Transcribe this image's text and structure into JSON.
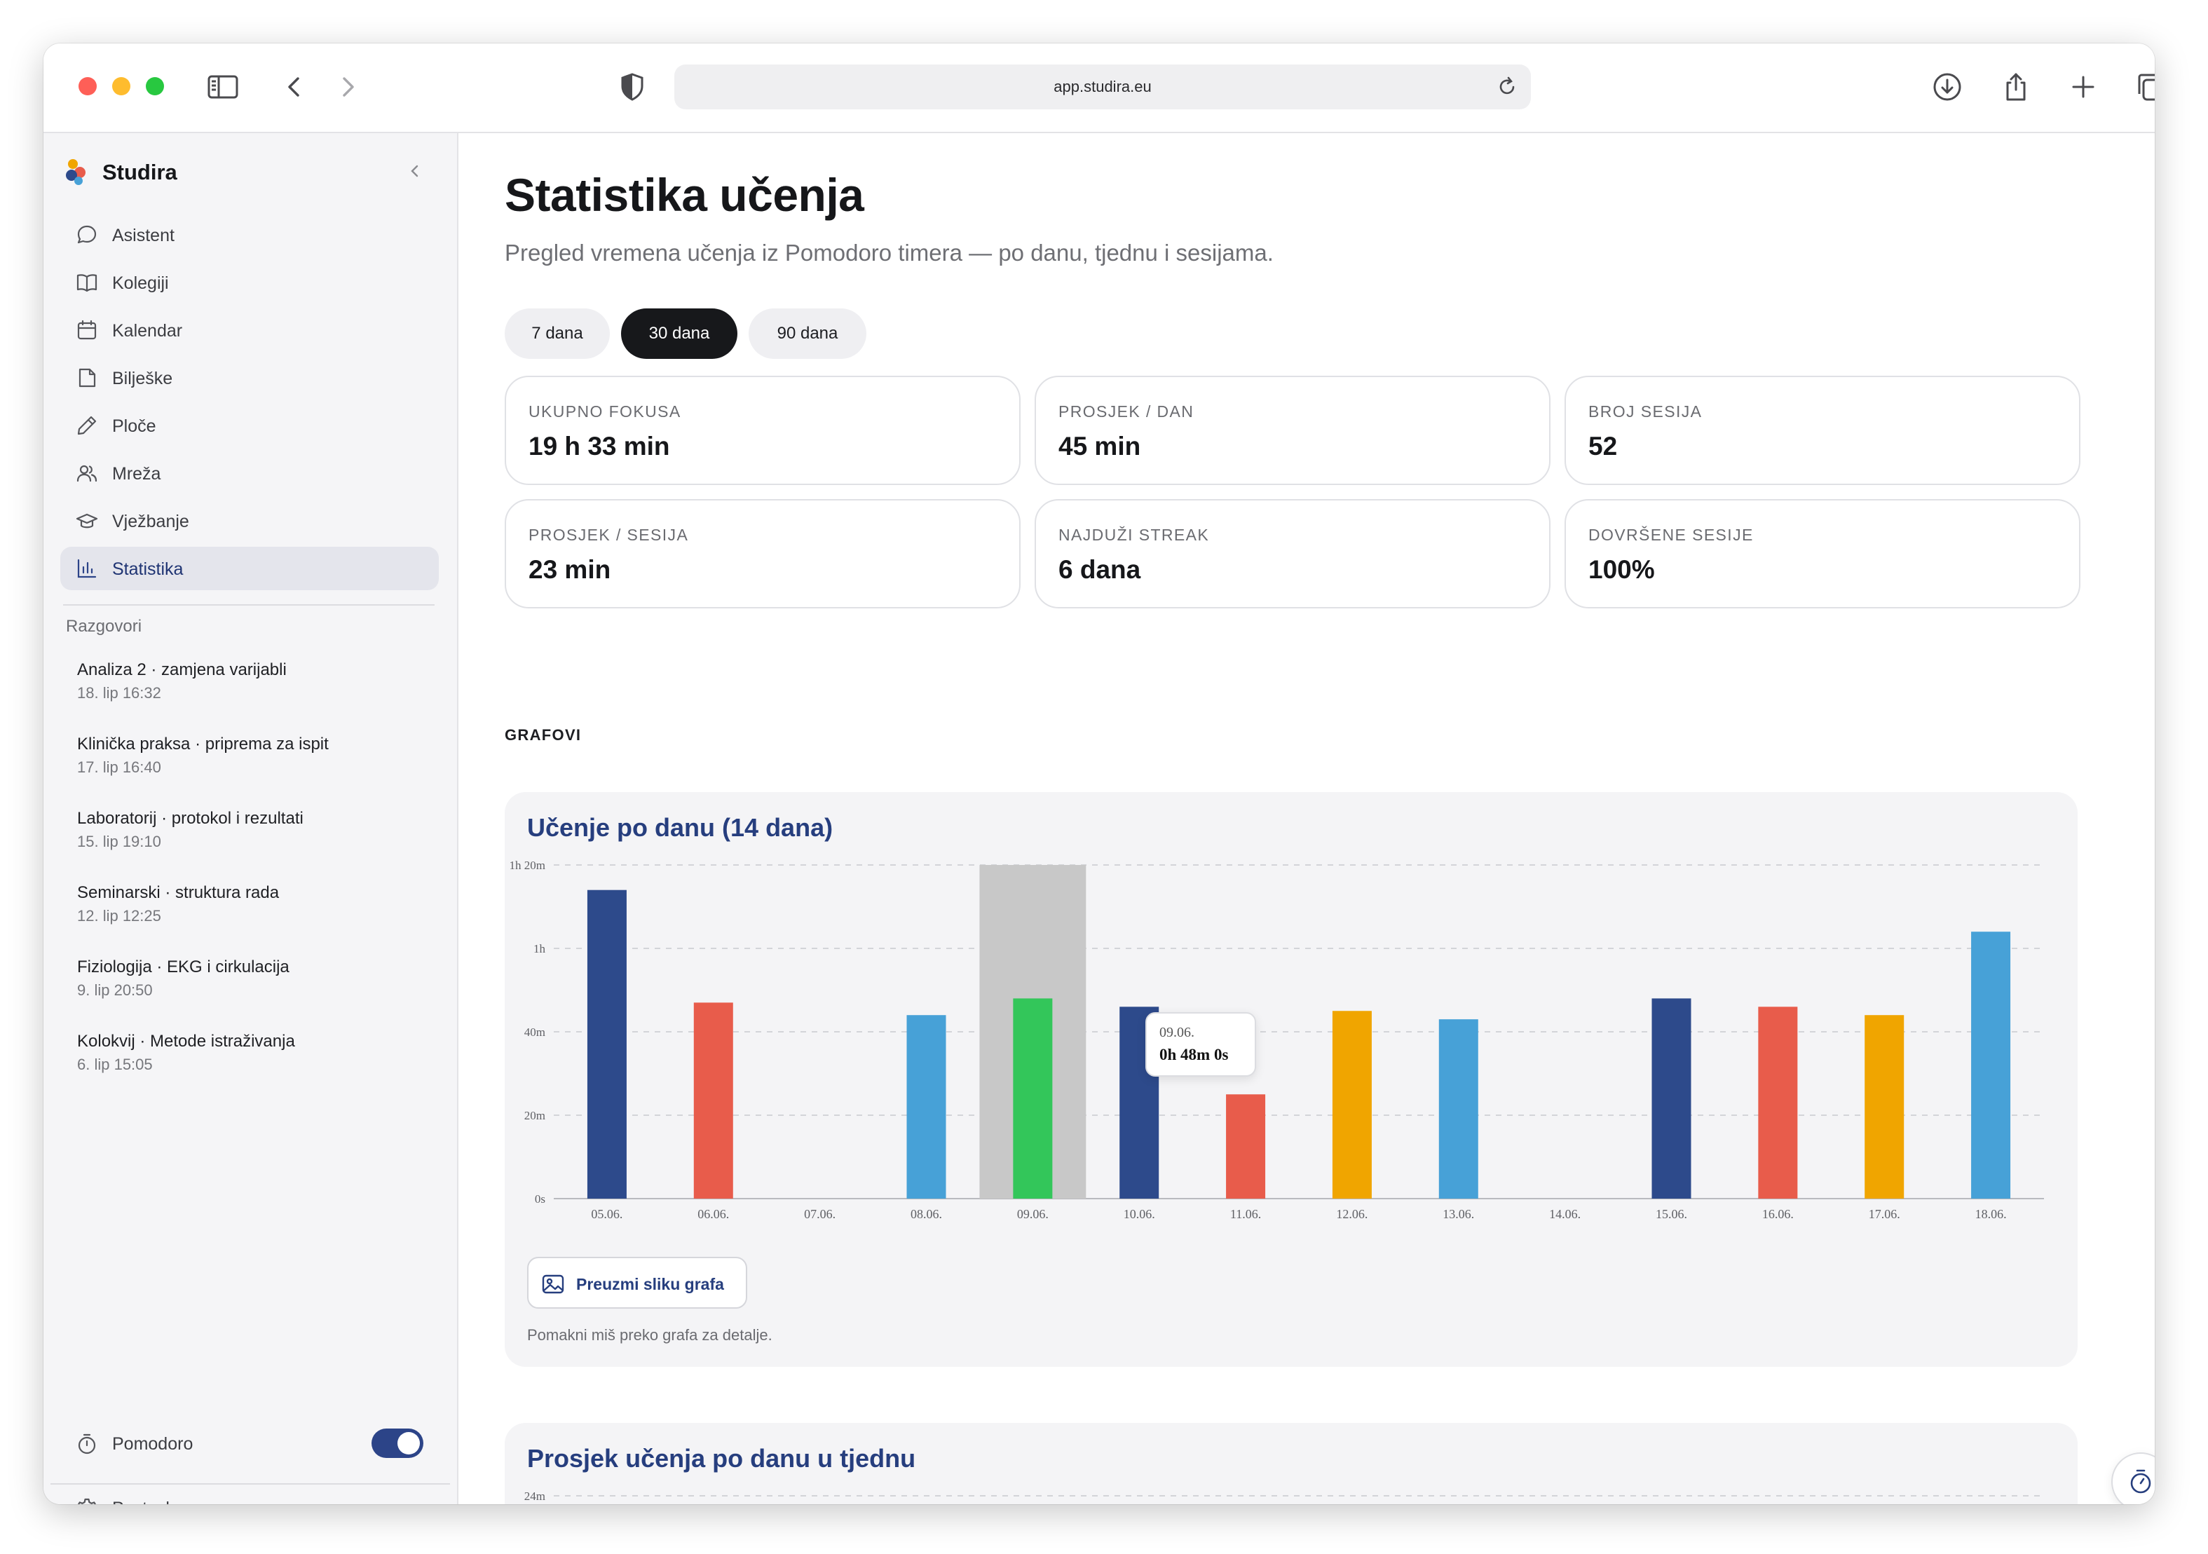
{
  "browser": {
    "url": "app.studira.eu"
  },
  "sidebar": {
    "brand": "Studira",
    "nav": [
      {
        "label": "Asistent",
        "icon": "chat-bubble-icon"
      },
      {
        "label": "Kolegiji",
        "icon": "book-icon"
      },
      {
        "label": "Kalendar",
        "icon": "calendar-icon"
      },
      {
        "label": "Bilješke",
        "icon": "note-icon"
      },
      {
        "label": "Ploče",
        "icon": "pencil-icon"
      },
      {
        "label": "Mreža",
        "icon": "users-icon"
      },
      {
        "label": "Vježbanje",
        "icon": "graduation-cap-icon"
      },
      {
        "label": "Statistika",
        "icon": "bar-chart-icon",
        "active": true
      }
    ],
    "conversations_label": "Razgovori",
    "conversations": [
      {
        "title": "Analiza 2 · zamjena varijabli",
        "date": "18. lip 16:32"
      },
      {
        "title": "Klinička praksa · priprema za ispit",
        "date": "17. lip 16:40"
      },
      {
        "title": "Laboratorij · protokol i rezultati",
        "date": "15. lip 19:10"
      },
      {
        "title": "Seminarski · struktura rada",
        "date": "12. lip 12:25"
      },
      {
        "title": "Fiziologija · EKG i cirkulacija",
        "date": "9. lip 20:50"
      },
      {
        "title": "Kolokvij · Metode istraživanja",
        "date": "6. lip 15:05"
      }
    ],
    "pomodoro_label": "Pomodoro",
    "pomodoro_on": true,
    "settings_label": "Postavke"
  },
  "main": {
    "title": "Statistika učenja",
    "subtitle": "Pregled vremena učenja iz Pomodoro timera — po danu, tjednu i sesijama.",
    "ranges": [
      {
        "label": "7 dana",
        "active": false
      },
      {
        "label": "30 dana",
        "active": true
      },
      {
        "label": "90 dana",
        "active": false
      }
    ],
    "stats": [
      {
        "label": "UKUPNO FOKUSA",
        "value": "19 h 33 min"
      },
      {
        "label": "PROSJEK / DAN",
        "value": "45 min"
      },
      {
        "label": "BROJ SESIJA",
        "value": "52"
      },
      {
        "label": "PROSJEK / SESIJA",
        "value": "23 min"
      },
      {
        "label": "NAJDUŽI STREAK",
        "value": "6 dana"
      },
      {
        "label": "DOVRŠENE SESIJE",
        "value": "100%"
      }
    ],
    "section_label": "GRAFOVI",
    "download_label": "Preuzmi sliku grafa",
    "hint": "Pomakni miš preko grafa za detalje.",
    "tooltip": {
      "date": "09.06.",
      "value": "0h 48m 0s"
    },
    "second_chart_title": "Prosjek učenja po danu u tjednu"
  },
  "colors": {
    "navy": "#2d4a8b",
    "red": "#e85c4b",
    "blue": "#47a1d7",
    "green": "#33c65a",
    "orange": "#f0a500",
    "highlight": "#c8c8c8"
  },
  "chart_data": [
    {
      "type": "bar",
      "title": "Učenje po danu (14 dana)",
      "categories": [
        "05.06.",
        "06.06.",
        "07.06.",
        "08.06.",
        "09.06.",
        "10.06.",
        "11.06.",
        "12.06.",
        "13.06.",
        "14.06.",
        "15.06.",
        "16.06.",
        "17.06.",
        "18.06."
      ],
      "values": [
        74,
        47,
        0,
        44,
        48,
        46,
        25,
        45,
        43,
        0,
        48,
        46,
        44,
        64
      ],
      "value_unit": "minutes",
      "bar_colors": [
        "#2d4a8b",
        "#e85c4b",
        "#47a1d7",
        "#47a1d7",
        "#33c65a",
        "#2d4a8b",
        "#e85c4b",
        "#f0a500",
        "#47a1d7",
        "#33c65a",
        "#2d4a8b",
        "#e85c4b",
        "#f0a500",
        "#47a1d7"
      ],
      "highlighted_category": "09.06.",
      "y_ticks": [
        {
          "value": 0,
          "label": "0s"
        },
        {
          "value": 20,
          "label": "20m"
        },
        {
          "value": 40,
          "label": "40m"
        },
        {
          "value": 60,
          "label": "1h"
        },
        {
          "value": 80,
          "label": "1h 20m"
        }
      ],
      "ylim": [
        0,
        80
      ],
      "grid": true
    },
    {
      "type": "bar",
      "title": "Prosjek učenja po danu u tjednu",
      "y_ticks": [
        {
          "value": 24,
          "label": "24m"
        }
      ],
      "visible_bar_colors": [
        "#e85c4b",
        "#f0a500",
        "#33c65a"
      ]
    }
  ]
}
